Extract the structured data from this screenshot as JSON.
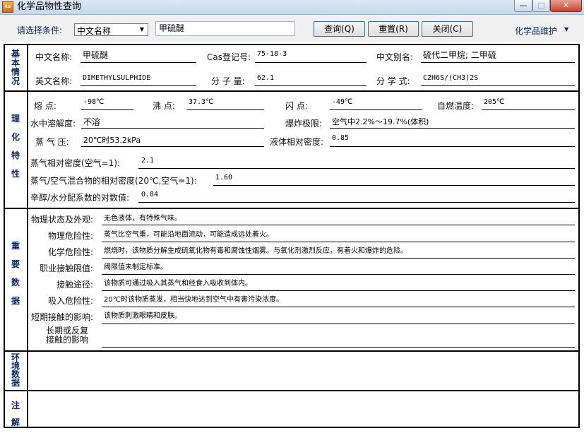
{
  "window": {
    "title": "化学品物性查询",
    "icon_text": "ku"
  },
  "toolbar": {
    "condition_label": "请选择条件:",
    "condition_value": "中文名称",
    "search_value": "甲硫醚",
    "query_label": "查询(Q)",
    "reset_label": "重置(R)",
    "close_label": "关闭(C)",
    "maintenance_label": "化学品维护"
  },
  "sections": {
    "basic": "基本情况",
    "physical": "理化特性",
    "important": "重要数据",
    "environment": "环境数据",
    "notes": "注解"
  },
  "basic": {
    "cn_name_label": "中文名称:",
    "cn_name": "甲硫醚",
    "cas_label": "Cas登记号:",
    "cas": "75-18-3",
    "alias_label": "中文别名:",
    "alias": "硫代二甲烷; 二甲硫",
    "en_name_label": "英文名称:",
    "en_name": "DIMETHYLSULPHIDE",
    "mw_label": "分 子 量:",
    "mw": "62.1",
    "formula_label": "分 学 式:",
    "formula": "C2H6S/(CH3)2S"
  },
  "physical": {
    "melting_label": "熔    点:",
    "melting": "-98℃",
    "boiling_label": "沸    点:",
    "boiling": "37.3℃",
    "flash_label": "闪    点:",
    "flash": "-49℃",
    "autoignition_label": "自燃温度:",
    "autoignition": "205℃",
    "solubility_label": "水中溶解度:",
    "solubility": "不溶",
    "explosive_label": "爆炸极限:",
    "explosive": "空气中2.2%～19.7%(体积)",
    "vapor_pressure_label": "蒸 气 压:",
    "vapor_pressure": "20℃时53.2kPa",
    "liquid_density_label": "液体相对密度:",
    "liquid_density": "0.85",
    "vapor_density_label": "蒸气相对密度(空气=1):",
    "vapor_density": "2.1",
    "mixture_density_label": "蒸气/空气混合物的相对密度(20℃,空气=1):",
    "mixture_density": "1.60",
    "partition_label": "辛醇/水分配系数的对数值:",
    "partition": "0.84"
  },
  "important": [
    {
      "label": "物理状态及外观:",
      "value": "无色液体，有特殊气味。"
    },
    {
      "label": "物理危险性:",
      "value": "蒸气比空气重，可能沿地面流动，可能造成远处着火。"
    },
    {
      "label": "化学危险性:",
      "value": "燃烧时，该物质分解生成硫氧化物有毒和腐蚀性烟雾。与氧化剂激烈反应，有着火和爆炸的危险。"
    },
    {
      "label": "职业接触限值:",
      "value": "阈限值未制定标准。"
    },
    {
      "label": "接触途径:",
      "value": "该物质可通过吸入其蒸气和经食入吸收到体内。"
    },
    {
      "label": "吸入危险性:",
      "value": "20℃时该物质蒸发，相当快地达到空气中有害污染浓度。"
    },
    {
      "label": "短期接触的影响:",
      "value": "该物质刺激眼睛和皮肤。"
    },
    {
      "label": "长期或反复接触的影响",
      "value": ""
    }
  ]
}
